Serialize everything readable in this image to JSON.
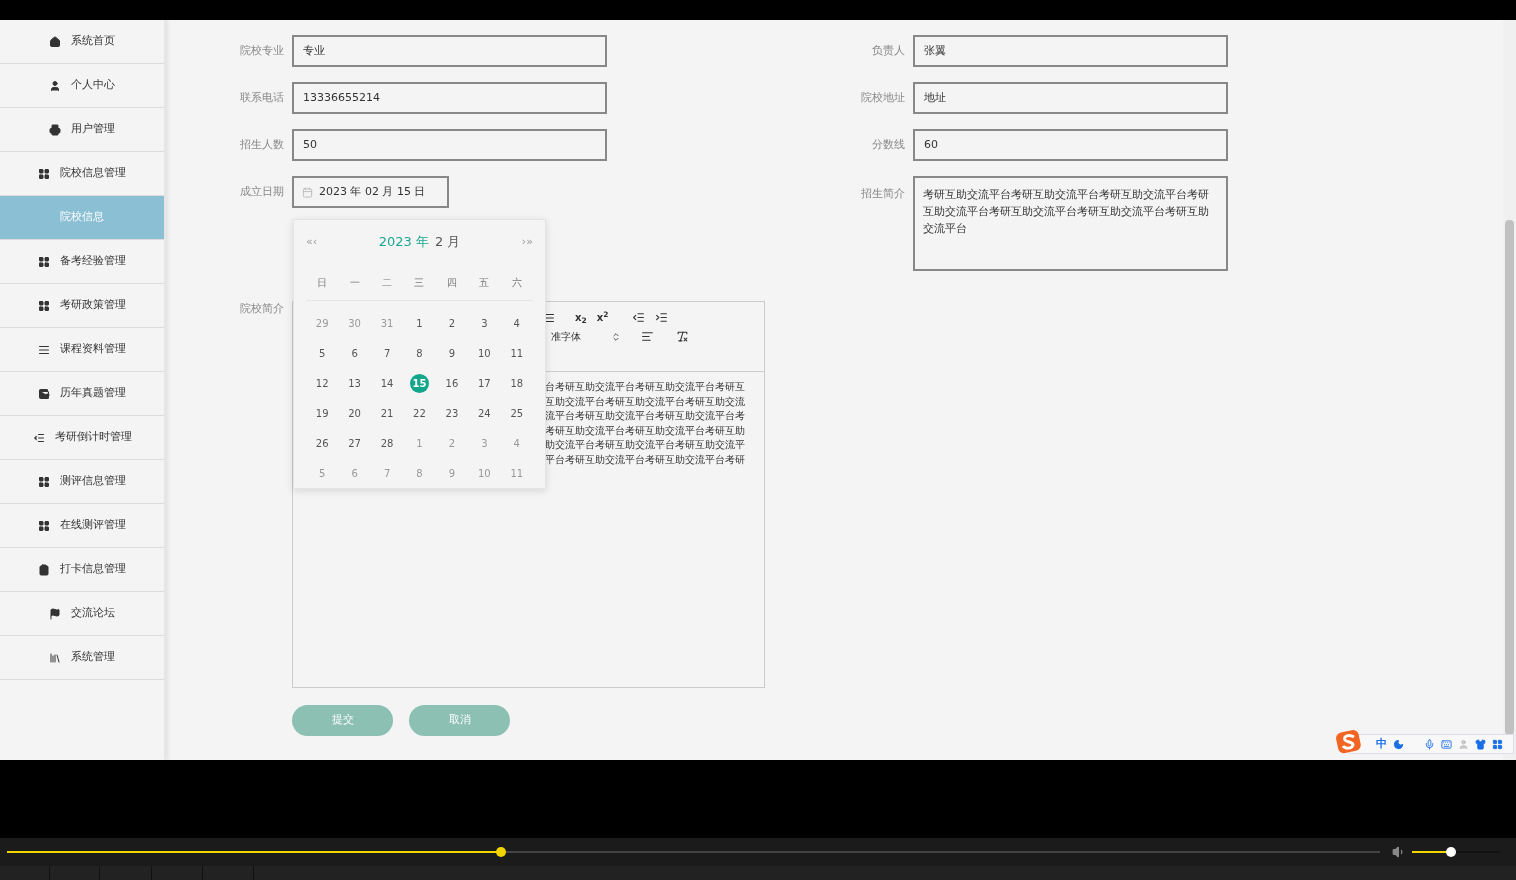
{
  "sidebar": {
    "items": [
      {
        "label": "系统首页",
        "selected": false
      },
      {
        "label": "个人中心",
        "selected": false
      },
      {
        "label": "用户管理",
        "selected": false
      },
      {
        "label": "院校信息管理",
        "selected": false
      },
      {
        "label": "院校信息",
        "selected": true
      },
      {
        "label": "备考经验管理",
        "selected": false
      },
      {
        "label": "考研政策管理",
        "selected": false
      },
      {
        "label": "课程资料管理",
        "selected": false
      },
      {
        "label": "历年真题管理",
        "selected": false
      },
      {
        "label": "考研倒计时管理",
        "selected": false
      },
      {
        "label": "测评信息管理",
        "selected": false
      },
      {
        "label": "在线测评管理",
        "selected": false
      },
      {
        "label": "打卡信息管理",
        "selected": false
      },
      {
        "label": "交流论坛",
        "selected": false
      },
      {
        "label": "系统管理",
        "selected": false
      }
    ]
  },
  "form": {
    "left_fields": [
      {
        "label": "院校专业",
        "value": "专业"
      },
      {
        "label": "联系电话",
        "value": "13336655214"
      },
      {
        "label": "招生人数",
        "value": "50"
      }
    ],
    "date_field": {
      "label": "成立日期",
      "value": "2023 年 02 月 15 日"
    },
    "right_fields": [
      {
        "label": "负责人",
        "value": "张翼"
      },
      {
        "label": "院校地址",
        "value": "地址"
      },
      {
        "label": "分数线",
        "value": "60"
      }
    ],
    "textarea": {
      "label": "招生简介",
      "value": "考研互助交流平台考研互助交流平台考研互助交流平台考研互助交流平台考研互助交流平台考研互助交流平台考研互助交流平台"
    },
    "editor": {
      "label": "院校简介",
      "subscript": "x$_{2}$",
      "superscript": "x$^{2}$",
      "font_select": "准字体",
      "lines": [
        "台考研互助交流平台考研互助交流平台考研互",
        "互助交流平台考研互助交流平台考研互助交流",
        "流平台考研互助交流平台考研互助交流平台考",
        "考研互助交流平台考研互助交流平台考研互助",
        "助交流平台考研互助交流平台考研互助交流平",
        "平台考研互助交流平台考研互助交流平台考研"
      ]
    },
    "buttons": [
      "提交",
      "取消"
    ]
  },
  "calendar": {
    "prev": "«‹",
    "next": "›»",
    "year": "2023 年",
    "month": "2 月",
    "weekdays": [
      "日",
      "一",
      "二",
      "三",
      "四",
      "五",
      "六"
    ],
    "weeks": [
      [
        {
          "d": "29",
          "kind": "other",
          "selected": false
        },
        {
          "d": "30",
          "kind": "other",
          "selected": false
        },
        {
          "d": "31",
          "kind": "other",
          "selected": false
        },
        {
          "d": "1",
          "kind": "current",
          "selected": false
        },
        {
          "d": "2",
          "kind": "current",
          "selected": false
        },
        {
          "d": "3",
          "kind": "current",
          "selected": false
        },
        {
          "d": "4",
          "kind": "current",
          "selected": false
        }
      ],
      [
        {
          "d": "5",
          "kind": "current",
          "selected": false
        },
        {
          "d": "6",
          "kind": "current",
          "selected": false
        },
        {
          "d": "7",
          "kind": "current",
          "selected": false
        },
        {
          "d": "8",
          "kind": "current",
          "selected": false
        },
        {
          "d": "9",
          "kind": "current",
          "selected": false
        },
        {
          "d": "10",
          "kind": "current",
          "selected": false
        },
        {
          "d": "11",
          "kind": "current",
          "selected": false
        }
      ],
      [
        {
          "d": "12",
          "kind": "current",
          "selected": false
        },
        {
          "d": "13",
          "kind": "current",
          "selected": false
        },
        {
          "d": "14",
          "kind": "current",
          "selected": false
        },
        {
          "d": "15",
          "kind": "current",
          "selected": true
        },
        {
          "d": "16",
          "kind": "current",
          "selected": false
        },
        {
          "d": "17",
          "kind": "current",
          "selected": false
        },
        {
          "d": "18",
          "kind": "current",
          "selected": false
        }
      ],
      [
        {
          "d": "19",
          "kind": "current",
          "selected": false
        },
        {
          "d": "20",
          "kind": "current",
          "selected": false
        },
        {
          "d": "21",
          "kind": "current",
          "selected": false
        },
        {
          "d": "22",
          "kind": "current",
          "selected": false
        },
        {
          "d": "23",
          "kind": "current",
          "selected": false
        },
        {
          "d": "24",
          "kind": "current",
          "selected": false
        },
        {
          "d": "25",
          "kind": "current",
          "selected": false
        }
      ],
      [
        {
          "d": "26",
          "kind": "current",
          "selected": false
        },
        {
          "d": "27",
          "kind": "current",
          "selected": false
        },
        {
          "d": "28",
          "kind": "current",
          "selected": false
        },
        {
          "d": "1",
          "kind": "other",
          "selected": false
        },
        {
          "d": "2",
          "kind": "other",
          "selected": false
        },
        {
          "d": "3",
          "kind": "other",
          "selected": false
        },
        {
          "d": "4",
          "kind": "other",
          "selected": false
        }
      ],
      [
        {
          "d": "5",
          "kind": "other",
          "selected": false
        },
        {
          "d": "6",
          "kind": "other",
          "selected": false
        },
        {
          "d": "7",
          "kind": "other",
          "selected": false
        },
        {
          "d": "8",
          "kind": "other",
          "selected": false
        },
        {
          "d": "9",
          "kind": "other",
          "selected": false
        },
        {
          "d": "10",
          "kind": "other",
          "selected": false
        },
        {
          "d": "11",
          "kind": "other",
          "selected": false
        }
      ]
    ]
  },
  "ime": {
    "mode": "中"
  },
  "player": {
    "progress": {
      "level": 0.36
    },
    "volume": {
      "level": 0.44
    }
  }
}
